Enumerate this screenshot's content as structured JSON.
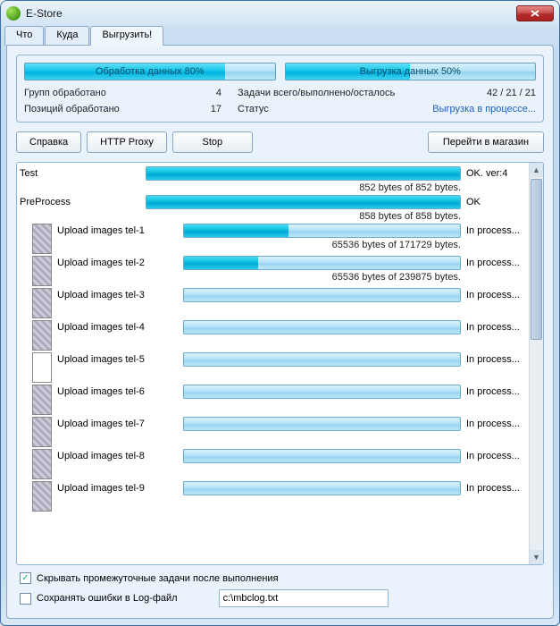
{
  "window": {
    "title": "E-Store"
  },
  "tabs": [
    {
      "label": "Что"
    },
    {
      "label": "Куда"
    },
    {
      "label": "Выгрузить!",
      "active": true
    }
  ],
  "summary": {
    "left_progress": {
      "label": "Обработка данных  80%",
      "pct": 80
    },
    "right_progress": {
      "label": "Выгрузка данных  50%",
      "pct": 50
    },
    "groups_label": "Групп обработано",
    "groups_value": "4",
    "positions_label": "Позиций обработано",
    "positions_value": "17",
    "tasks_label": "Задачи всего/выполнено/осталось",
    "tasks_value": "42 / 21 / 21",
    "status_label": "Статус",
    "status_value": "Выгрузка в процессе..."
  },
  "toolbar": {
    "help": "Справка",
    "proxy": "HTTP Proxy",
    "stop": "Stop",
    "goto": "Перейти в магазин"
  },
  "tasks": [
    {
      "name": "Test",
      "status": "OK. ver:4",
      "pct": 100,
      "bytes": "852 bytes of 852 bytes.",
      "thumb": "none"
    },
    {
      "name": "PreProcess",
      "status": "OK",
      "pct": 100,
      "bytes": "858 bytes of 858 bytes.",
      "thumb": "none"
    },
    {
      "name": "Upload images tel-1",
      "status": "In process...",
      "pct": 38,
      "bytes": "65536 bytes of 171729 bytes.",
      "thumb": "phone"
    },
    {
      "name": "Upload images tel-2",
      "status": "In process...",
      "pct": 27,
      "bytes": "65536 bytes of 239875 bytes.",
      "thumb": "phone"
    },
    {
      "name": "Upload images tel-3",
      "status": "In process...",
      "pct": 0,
      "bytes": "",
      "thumb": "phone"
    },
    {
      "name": "Upload images tel-4",
      "status": "In process...",
      "pct": 0,
      "bytes": "",
      "thumb": "phone"
    },
    {
      "name": "Upload images tel-5",
      "status": "In process...",
      "pct": 0,
      "bytes": "",
      "thumb": "blank"
    },
    {
      "name": "Upload images tel-6",
      "status": "In process...",
      "pct": 0,
      "bytes": "",
      "thumb": "phone"
    },
    {
      "name": "Upload images tel-7",
      "status": "In process...",
      "pct": 0,
      "bytes": "",
      "thumb": "phone"
    },
    {
      "name": "Upload images tel-8",
      "status": "In process...",
      "pct": 0,
      "bytes": "",
      "thumb": "phone"
    },
    {
      "name": "Upload images tel-9",
      "status": "In process...",
      "pct": 0,
      "bytes": "",
      "thumb": "phone"
    }
  ],
  "footer": {
    "hide_done": {
      "label": "Скрывать промежуточные задачи после выполнения",
      "checked": true
    },
    "save_log": {
      "label": "Сохранять ошибки в Log-файл",
      "checked": false
    },
    "log_path": "c:\\mbclog.txt"
  }
}
